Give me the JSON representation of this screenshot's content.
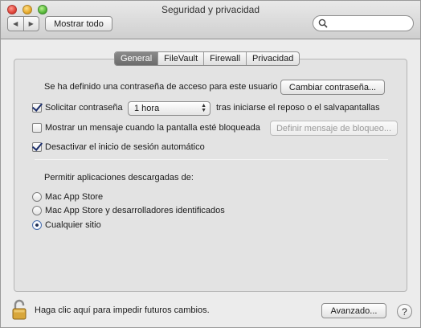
{
  "window": {
    "title": "Seguridad y privacidad"
  },
  "toolbar": {
    "back_glyph": "◀",
    "forward_glyph": "▶",
    "show_all_label": "Mostrar todo",
    "search_placeholder": ""
  },
  "tabs": [
    {
      "label": "General",
      "active": true
    },
    {
      "label": "FileVault",
      "active": false
    },
    {
      "label": "Firewall",
      "active": false
    },
    {
      "label": "Privacidad",
      "active": false
    }
  ],
  "general": {
    "password_set_text": "Se ha definido una contraseña de acceso para este usuario",
    "change_password_label": "Cambiar contraseña...",
    "require_password": {
      "label": "Solicitar contraseña",
      "checked": true
    },
    "require_password_delay": "1 hora",
    "require_password_suffix": "tras iniciarse el reposo o el salvapantallas",
    "show_message": {
      "label": "Mostrar un mensaje cuando la pantalla esté bloqueada",
      "checked": false
    },
    "set_lock_message_label": "Definir mensaje de bloqueo...",
    "disable_auto_login": {
      "label": "Desactivar el inicio de sesión automático",
      "checked": true
    },
    "allow_apps_heading": "Permitir aplicaciones descargadas de:",
    "allow_apps_options": [
      {
        "label": "Mac App Store",
        "selected": false
      },
      {
        "label": "Mac App Store y desarrolladores identificados",
        "selected": false
      },
      {
        "label": "Cualquier sitio",
        "selected": true
      }
    ]
  },
  "footer": {
    "lock_text": "Haga clic aquí para impedir futuros cambios.",
    "advanced_label": "Avanzado...",
    "help_glyph": "?",
    "lock_icon": "unlocked-padlock-icon"
  }
}
